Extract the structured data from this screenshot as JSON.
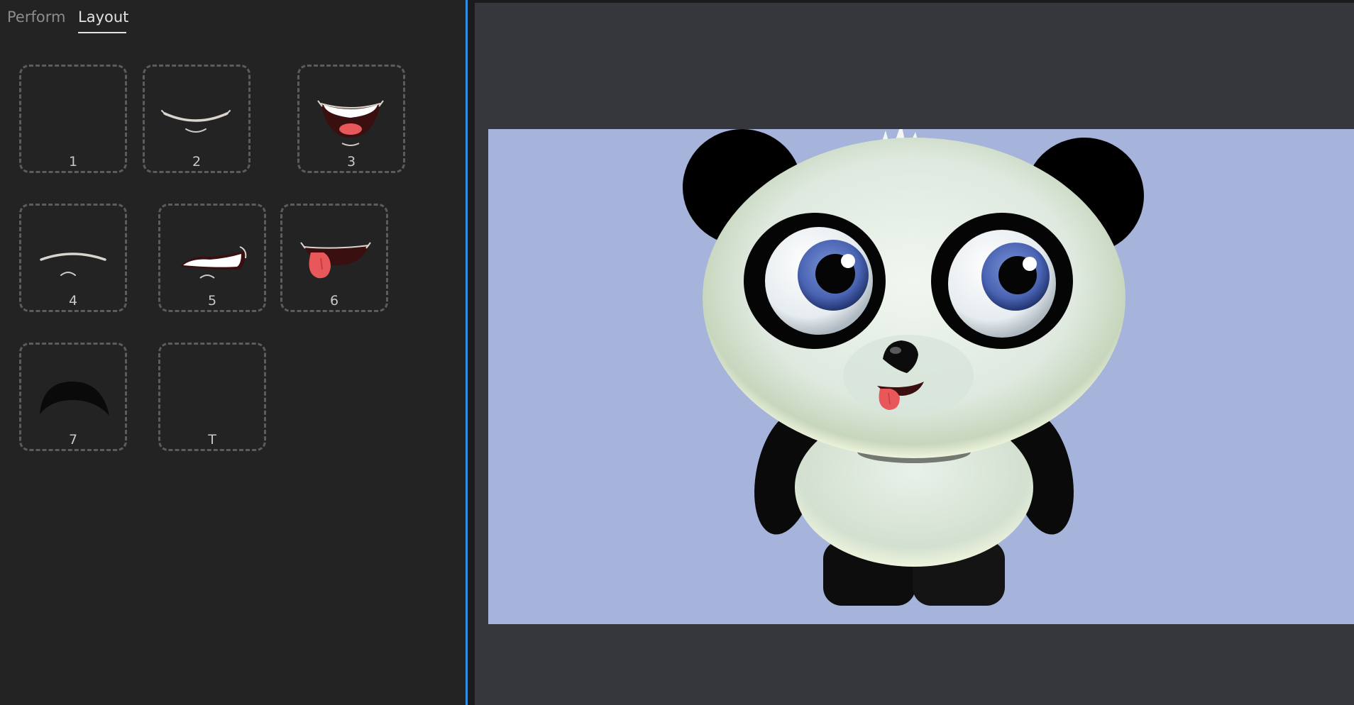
{
  "tabs": [
    {
      "label": "Perform",
      "active": false
    },
    {
      "label": "Layout",
      "active": true
    }
  ],
  "slots": [
    {
      "label": "1",
      "icon": "empty"
    },
    {
      "label": "2",
      "icon": "mouth-smile-closed-icon"
    },
    {
      "label": "3",
      "icon": "mouth-open-smile-icon"
    },
    {
      "label": "4",
      "icon": "mouth-neutral-icon"
    },
    {
      "label": "5",
      "icon": "mouth-grimace-icon"
    },
    {
      "label": "6",
      "icon": "mouth-tongue-out-icon"
    },
    {
      "label": "7",
      "icon": "mouth-black-arc-icon"
    },
    {
      "label": "T",
      "icon": "empty"
    }
  ],
  "colors": {
    "panel_bg": "#232323",
    "stage_bg": "#36373c",
    "scene_bg": "#a6b3da",
    "divider": "#2f8fe0",
    "slot_border": "#5c5c5c",
    "tongue": "#e8585a"
  },
  "character": "panda-character"
}
